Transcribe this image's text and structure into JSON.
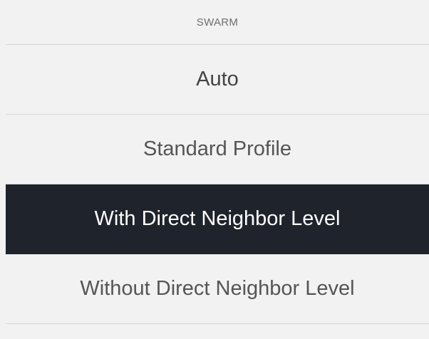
{
  "menu": {
    "title": "SWARM",
    "options": [
      {
        "label": "Auto",
        "selected": false
      },
      {
        "label": "Standard Profile",
        "selected": false
      },
      {
        "label": "With Direct Neighbor Level",
        "selected": true
      },
      {
        "label": "Without Direct Neighbor Level",
        "selected": false
      }
    ]
  },
  "colors": {
    "background": "#f2f2f2",
    "selected_background": "#1f232b",
    "selected_text": "#ffffff",
    "text": "#555555",
    "header_text": "#6f6f6f",
    "divider": "#d6d6d6"
  }
}
